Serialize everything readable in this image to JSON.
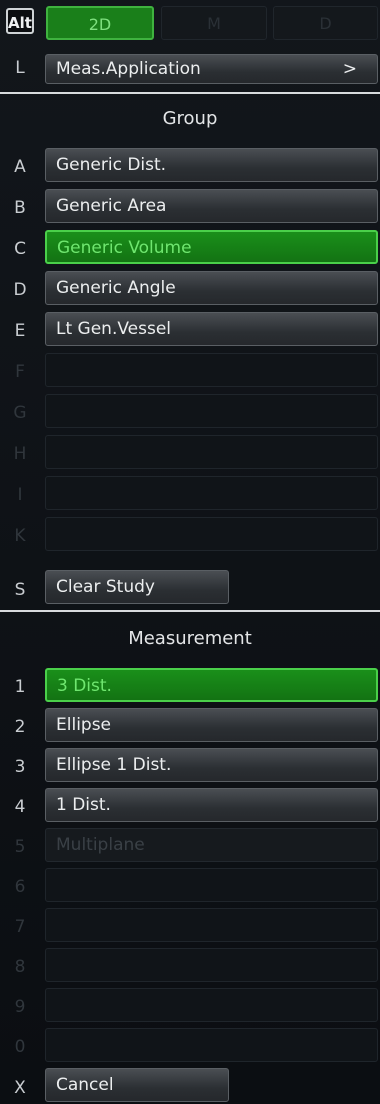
{
  "alt_label": "Alt",
  "mode_tabs": [
    {
      "label": "2D",
      "state": "active"
    },
    {
      "label": "M",
      "state": "inactive"
    },
    {
      "label": "D",
      "state": "inactive"
    }
  ],
  "app_row": {
    "key": "L",
    "label": "Meas.Application",
    "arrow": ">"
  },
  "group": {
    "title": "Group",
    "items": [
      {
        "key": "A",
        "label": "Generic Dist.",
        "state": "normal"
      },
      {
        "key": "B",
        "label": "Generic Area",
        "state": "normal"
      },
      {
        "key": "C",
        "label": "Generic Volume",
        "state": "selected"
      },
      {
        "key": "D",
        "label": "Generic Angle",
        "state": "normal"
      },
      {
        "key": "E",
        "label": "Lt Gen.Vessel",
        "state": "normal"
      },
      {
        "key": "F",
        "label": "",
        "state": "empty"
      },
      {
        "key": "G",
        "label": "",
        "state": "empty"
      },
      {
        "key": "H",
        "label": "",
        "state": "empty"
      },
      {
        "key": "I",
        "label": "",
        "state": "empty"
      },
      {
        "key": "K",
        "label": "",
        "state": "empty"
      }
    ],
    "clear": {
      "key": "S",
      "label": "Clear Study"
    }
  },
  "measurement": {
    "title": "Measurement",
    "items": [
      {
        "key": "1",
        "label": "3 Dist.",
        "state": "selected"
      },
      {
        "key": "2",
        "label": "Ellipse",
        "state": "normal"
      },
      {
        "key": "3",
        "label": "Ellipse 1 Dist.",
        "state": "normal"
      },
      {
        "key": "4",
        "label": "1 Dist.",
        "state": "normal"
      },
      {
        "key": "5",
        "label": "Multiplane",
        "state": "disabled"
      },
      {
        "key": "6",
        "label": "",
        "state": "empty"
      },
      {
        "key": "7",
        "label": "",
        "state": "empty"
      },
      {
        "key": "8",
        "label": "",
        "state": "empty"
      },
      {
        "key": "9",
        "label": "",
        "state": "empty"
      },
      {
        "key": "0",
        "label": "",
        "state": "empty"
      }
    ],
    "cancel": {
      "key": "X",
      "label": "Cancel"
    }
  }
}
